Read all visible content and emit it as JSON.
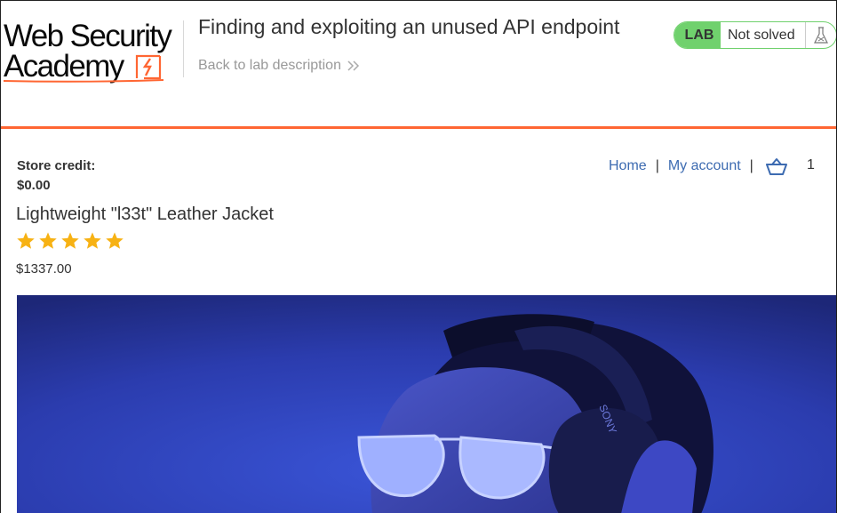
{
  "header": {
    "logo_line1": "Web Security",
    "logo_line2": "Academy",
    "lab_title": "Finding and exploiting an unused API endpoint",
    "back_link": "Back to lab description",
    "lab_badge": "LAB",
    "lab_status": "Not solved"
  },
  "account": {
    "store_credit_label": "Store credit:",
    "store_credit_value": "$0.00"
  },
  "nav": {
    "home": "Home",
    "separator": "|",
    "my_account": "My account",
    "cart_count": "1"
  },
  "product": {
    "name": "Lightweight \"l33t\" Leather Jacket",
    "rating": 5,
    "rating_max": 5,
    "price": "$1337.00",
    "headphone_brand": "SONY"
  },
  "colors": {
    "accent": "#ff6633",
    "link": "#3d6bb1",
    "lab_green": "#70d16d",
    "star": "#f7b214"
  }
}
